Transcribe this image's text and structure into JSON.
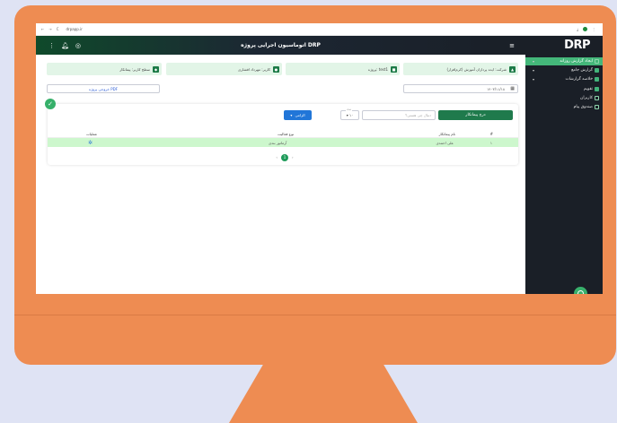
{
  "browser": {
    "url": "drpapp.ir",
    "nav": [
      "←",
      "→",
      "C"
    ]
  },
  "header": {
    "title": "اتوماسیون اجرایی پروژه DRP"
  },
  "sidebar": {
    "logo": "DRP",
    "items": [
      {
        "label": "ایجاد گزارش روزانه",
        "active": true
      },
      {
        "label": "گزارش جامع",
        "active": false
      },
      {
        "label": "خلاصه گزارشات",
        "active": false
      },
      {
        "label": "تقویم",
        "active": false
      },
      {
        "label": "کاربران",
        "active": false
      },
      {
        "label": "صندوق پیام",
        "active": false
      }
    ]
  },
  "info": {
    "company": "شرکت: ایده پردازان آموزش (کرم‌افزار)",
    "project": "پروژه: test1",
    "user": "کاربر: مهرداد افشاری",
    "access": "سطح کاربر: پیمانکار"
  },
  "toolbar": {
    "pdf_label": "خروجی پروژه PDF",
    "date_value": "۱۴۰۳/۱۱/۱۸"
  },
  "panel": {
    "add_label": "درج پیمانکار",
    "search_placeholder": "دنبال چی هستی؟",
    "per_page_label": "تعداد",
    "per_page_value": "۱۰",
    "alert_label": "الزامی"
  },
  "table": {
    "headers": [
      "#",
      "نام پیمانکار",
      "نوع فعالیت",
      "عملیات"
    ],
    "rows": [
      {
        "index": "۱",
        "name": "علی احمدی",
        "activity": "آرماتور بندی"
      }
    ]
  },
  "pagination": {
    "prev": "‹",
    "current": "1",
    "next": "›"
  },
  "colors": {
    "accent": "#1f7a4c",
    "monitor": "#ee8c52",
    "sidebar": "#1a1f27"
  }
}
